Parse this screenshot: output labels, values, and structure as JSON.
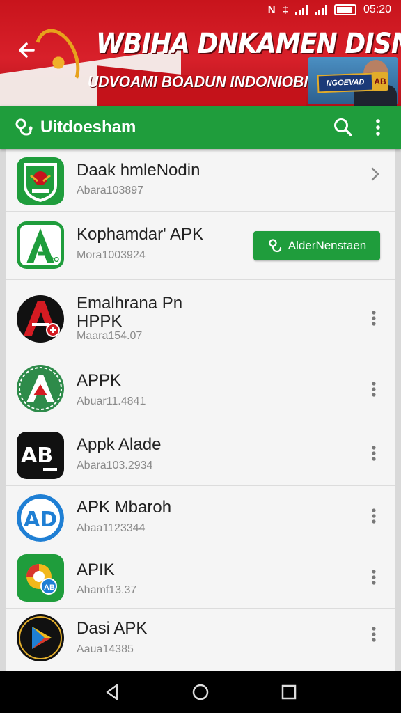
{
  "status_bar": {
    "time": "05:20",
    "icons": [
      "nfc-icon",
      "vibrate-icon",
      "signal-icon",
      "signal-icon",
      "battery-icon"
    ]
  },
  "banner": {
    "title": "WBIHA DNKAMEN DISNGN",
    "subtitle": "UDVOAMI BOADUN INDONIOBIS",
    "badge": "NGOEVAD",
    "badge_small": "AB"
  },
  "app_bar": {
    "title": "Uitdoesham",
    "icons": [
      "app-logo-icon",
      "search-icon",
      "more-vert-icon"
    ]
  },
  "apps": [
    {
      "name": "Daak hmleNodin",
      "sub": "Abara103897",
      "icon": "garuda-emblem-icon",
      "trailing": "chevron"
    },
    {
      "name": "Kophamdar' APK",
      "sub": "Mora1003924",
      "icon": "green-a-icon",
      "trailing": "button",
      "button_label": "AlderNenstaen"
    },
    {
      "name": "Emalhrana Pn\nHPPK",
      "sub": "Maara154.07",
      "icon": "red-a-icon",
      "trailing": "menu"
    },
    {
      "name": "APPK",
      "sub": "Abuar11.4841",
      "icon": "green-circle-a-icon",
      "trailing": "menu"
    },
    {
      "name": "Appk Alade",
      "sub": "Abara103.2934",
      "icon": "ab-logo-icon",
      "trailing": "menu"
    },
    {
      "name": "APK Mbaroh",
      "sub": "Abaa1123344",
      "icon": "blue-ad-icon",
      "trailing": "menu"
    },
    {
      "name": "APIK",
      "sub": "Ahamf13.37",
      "icon": "colorful-circle-icon",
      "trailing": "menu"
    },
    {
      "name": "Dasi APK",
      "sub": "Aaua14385",
      "icon": "play-store-icon",
      "trailing": "menu"
    }
  ],
  "colors": {
    "banner_red": "#c8141c",
    "app_bar_green": "#1f9d3c",
    "list_bg": "#f5f5f5"
  },
  "nav_bar": [
    "back-nav-icon",
    "home-nav-icon",
    "recents-nav-icon"
  ]
}
